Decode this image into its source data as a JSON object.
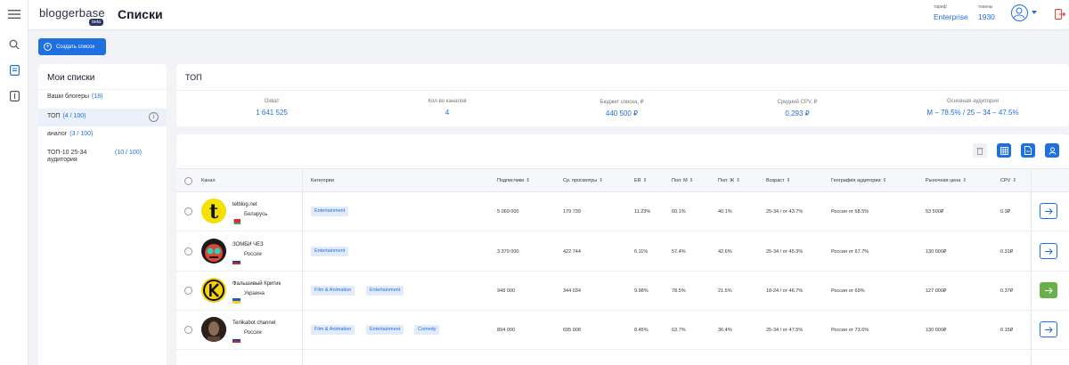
{
  "header": {
    "logo": "bloggerbase",
    "beta": "beta",
    "title": "Списки",
    "tariff_label": "тариф",
    "tariff_value": "Enterprise",
    "tokens_label": "токены",
    "tokens_value": "1930"
  },
  "create_button": "Создать список",
  "lists": {
    "title": "Мои списки",
    "items": [
      {
        "label": "Ваши блогеры",
        "count": "(18)"
      },
      {
        "label": "ТОП",
        "count": "(4 / 100)"
      },
      {
        "label": "аналог",
        "count": "(3 / 100)"
      },
      {
        "label": "ТОП-10 25-34 аудитория",
        "count": "(10 / 100)"
      }
    ]
  },
  "summary": {
    "title": "ТОП",
    "metrics": [
      {
        "label": "Охват",
        "value": "1 641 525"
      },
      {
        "label": "Кол-во каналов",
        "value": "4"
      },
      {
        "label": "Бюджет списка, ₽",
        "value": "440 500 ₽"
      },
      {
        "label": "Средний CPV, ₽",
        "value": "0,293 ₽"
      },
      {
        "label": "Основная аудитория",
        "value": "М – 78.5%  /  25 – 34 – 47.5%"
      }
    ]
  },
  "table": {
    "columns": [
      "Канал",
      "Категории",
      "Подписчики",
      "Ср. просмотры",
      "ER",
      "Пол: М",
      "Пол: Ж",
      "Возраст",
      "География аудитории",
      "Рыночная цена",
      "CPV"
    ],
    "rows": [
      {
        "name": "telblog.net",
        "country": "Беларусь",
        "tags": [
          "Entertainment"
        ],
        "subs": "5 060 000",
        "views": "179 739",
        "er": "11.23%",
        "m": "60.1%",
        "f": "40.1%",
        "age": "25-34 / от 43.7%",
        "geo": "Россия от 68.5%",
        "price": "53 500₽",
        "cpv": "0.3₽"
      },
      {
        "name": "ЗОМБИ ЧЕЗ",
        "country": "Россия",
        "tags": [
          "Entertainment"
        ],
        "subs": "3 370 000",
        "views": "422 744",
        "er": "6.11%",
        "m": "57.4%",
        "f": "42.6%",
        "age": "25-34 / от 45.3%",
        "geo": "Россия от 67.7%",
        "price": "130 000₽",
        "cpv": "0.31₽"
      },
      {
        "name": "Фальшивый Критик",
        "country": "Украина",
        "tags": [
          "Film & Animation",
          "Entertainment"
        ],
        "subs": "948 000",
        "views": "344 034",
        "er": "9.98%",
        "m": "78.5%",
        "f": "21.5%",
        "age": "18-24 / от 46.7%",
        "geo": "Россия от 69%",
        "price": "127 000₽",
        "cpv": "0.37₽"
      },
      {
        "name": "Terlikabot channel",
        "country": "Россия",
        "tags": [
          "Film & Animation",
          "Entertainment",
          "Comedy"
        ],
        "subs": "894 000",
        "views": "695 008",
        "er": "8.45%",
        "m": "63.7%",
        "f": "36.4%",
        "age": "25-34 / от 47.5%",
        "geo": "Россия от 73.6%",
        "price": "130 000₽",
        "cpv": "0.15₽"
      }
    ]
  },
  "icons": {
    "menu": "hamburger-icon",
    "search": "search-icon",
    "lists": "document-icon",
    "info": "info-icon",
    "logout": "logout-icon",
    "delete": "trash-icon",
    "excel": "table-icon",
    "pdf": "file-icon",
    "share": "user-icon",
    "open": "arrow-right-icon"
  },
  "colors": {
    "accent": "#1e6fe0",
    "active_row_button": "#67b04a",
    "background": "#f2f3f7"
  }
}
